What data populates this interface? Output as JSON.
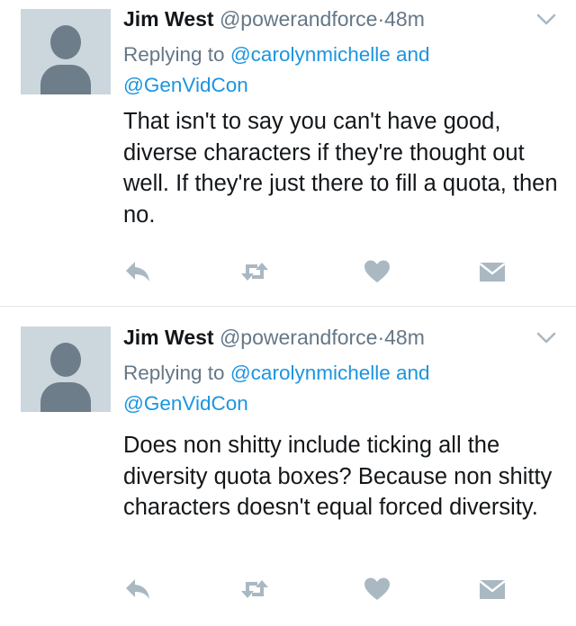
{
  "tweets": [
    {
      "name": "Jim West",
      "handle": "@powerandforce",
      "separator": "·",
      "time": "48m",
      "replying": {
        "prefix": "Replying to",
        "mention_1": "@carolynmichelle",
        "joiner": "and",
        "mention_2": "@GenVidCon"
      },
      "text": "That isn't to say you can't have good, diverse characters if they're thought out well.  If they're just there to fill a quota, then no.",
      "icons": {
        "menu": "chevron-down-icon",
        "reply": "reply-icon",
        "retweet": "retweet-icon",
        "like": "heart-icon",
        "dm": "envelope-icon"
      }
    },
    {
      "name": "Jim West",
      "handle": "@powerandforce",
      "separator": "·",
      "time": "48m",
      "replying": {
        "prefix": "Replying to",
        "mention_1": "@carolynmichelle",
        "joiner": "and",
        "mention_2": "@GenVidCon"
      },
      "text": "Does non shitty include ticking all the diversity quota boxes?  Because non shitty characters doesn't equal forced diversity.",
      "icons": {
        "menu": "chevron-down-icon",
        "reply": "reply-icon",
        "retweet": "retweet-icon",
        "like": "heart-icon",
        "dm": "envelope-icon"
      }
    }
  ],
  "colors": {
    "text": "#14171a",
    "muted": "#657786",
    "link": "#1b95e0",
    "icon": "#aab8c2",
    "avatar_bg": "#ccd6dd",
    "avatar_fg": "#6d7d8a",
    "divider": "#e1e8ed"
  }
}
